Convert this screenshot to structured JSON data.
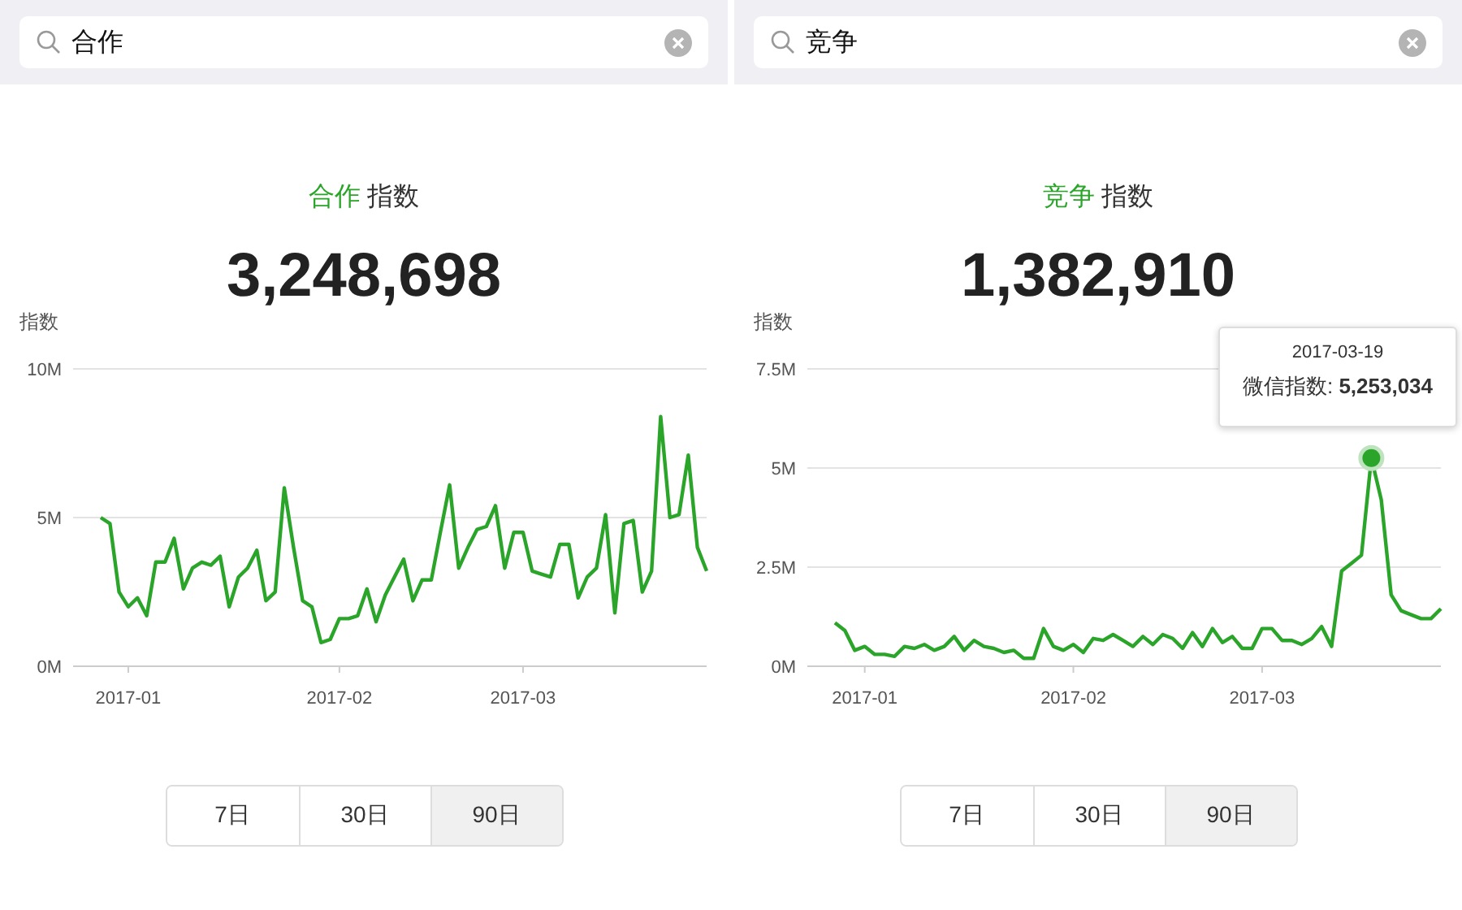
{
  "panels": [
    {
      "search": {
        "value": "合作"
      },
      "title": {
        "keyword": "合作",
        "label": "指数"
      },
      "total": "3,248,698",
      "chart_data": {
        "type": "line",
        "ylabel": "指数",
        "categories": [
          null,
          null,
          null,
          "2017-01",
          null,
          null,
          null,
          null,
          null,
          null,
          null,
          null,
          null,
          null,
          null,
          null,
          null,
          null,
          null,
          null,
          null,
          null,
          null,
          null,
          null,
          null,
          "2017-02",
          null,
          null,
          null,
          null,
          null,
          null,
          null,
          null,
          null,
          null,
          null,
          null,
          null,
          null,
          null,
          null,
          null,
          null,
          null,
          "2017-03",
          null,
          null,
          null,
          null,
          null,
          null,
          null,
          null,
          null,
          null,
          null,
          null,
          null,
          null,
          null,
          null,
          null,
          null,
          null,
          null
        ],
        "ylim": [
          0,
          10
        ],
        "yticks": [
          {
            "value": 0,
            "label": "0M"
          },
          {
            "value": 5,
            "label": "5M"
          },
          {
            "value": 10,
            "label": "10M"
          }
        ],
        "series": [
          {
            "color": "#2aa52a",
            "values": [
              5.0,
              4.8,
              2.5,
              2.0,
              2.3,
              1.7,
              3.5,
              3.5,
              4.3,
              2.6,
              3.3,
              3.5,
              3.4,
              3.7,
              2.0,
              3.0,
              3.3,
              3.9,
              2.2,
              2.5,
              6.0,
              4.0,
              2.2,
              2.0,
              0.8,
              0.9,
              1.6,
              1.6,
              1.7,
              2.6,
              1.5,
              2.4,
              3.0,
              3.6,
              2.2,
              2.9,
              2.9,
              4.5,
              6.1,
              3.3,
              4.0,
              4.6,
              4.7,
              5.4,
              3.3,
              4.5,
              4.5,
              3.2,
              3.1,
              3.0,
              4.1,
              4.1,
              2.3,
              3.0,
              3.3,
              5.1,
              1.8,
              4.8,
              4.9,
              2.5,
              3.2,
              8.4,
              5.0,
              5.1,
              7.1,
              4.0,
              3.2
            ]
          }
        ]
      },
      "ranges": [
        {
          "label": "7日",
          "selected": false
        },
        {
          "label": "30日",
          "selected": false
        },
        {
          "label": "90日",
          "selected": true
        }
      ]
    },
    {
      "search": {
        "value": "竞争"
      },
      "title": {
        "keyword": "竞争",
        "label": "指数"
      },
      "total": "1,382,910",
      "tooltip": {
        "date": "2017-03-19",
        "text": "微信指数: **5,253,034**"
      },
      "chart_data": {
        "type": "line",
        "ylabel": "指数",
        "categories": [
          null,
          null,
          null,
          "2017-01",
          null,
          null,
          null,
          null,
          null,
          null,
          null,
          null,
          null,
          null,
          null,
          null,
          null,
          null,
          null,
          null,
          null,
          null,
          null,
          null,
          "2017-02",
          null,
          null,
          null,
          null,
          null,
          null,
          null,
          null,
          null,
          null,
          null,
          null,
          null,
          null,
          null,
          null,
          null,
          null,
          "2017-03",
          null,
          null,
          null,
          null,
          null,
          null,
          null,
          null,
          null,
          null,
          null,
          null,
          null,
          null,
          null,
          null,
          null,
          null
        ],
        "ylim": [
          0,
          7.5
        ],
        "yticks": [
          {
            "value": 0,
            "label": "0M"
          },
          {
            "value": 2.5,
            "label": "2.5M"
          },
          {
            "value": 5,
            "label": "5M"
          },
          {
            "value": 7.5,
            "label": "7.5M"
          }
        ],
        "series": [
          {
            "color": "#2aa52a",
            "values": [
              1.1,
              0.9,
              0.4,
              0.5,
              0.3,
              0.3,
              0.25,
              0.5,
              0.45,
              0.55,
              0.4,
              0.5,
              0.75,
              0.4,
              0.65,
              0.5,
              0.45,
              0.35,
              0.4,
              0.2,
              0.2,
              0.95,
              0.5,
              0.4,
              0.55,
              0.35,
              0.7,
              0.65,
              0.8,
              0.65,
              0.5,
              0.75,
              0.55,
              0.8,
              0.7,
              0.45,
              0.85,
              0.5,
              0.95,
              0.6,
              0.75,
              0.45,
              0.45,
              0.95,
              0.95,
              0.65,
              0.65,
              0.55,
              0.7,
              1.0,
              0.5,
              2.4,
              2.6,
              2.8,
              5.25,
              4.2,
              1.8,
              1.4,
              1.3,
              1.2,
              1.2,
              1.45
            ]
          }
        ]
      },
      "ranges": [
        {
          "label": "7日",
          "selected": false
        },
        {
          "label": "30日",
          "selected": false
        },
        {
          "label": "90日",
          "selected": true
        }
      ]
    }
  ]
}
